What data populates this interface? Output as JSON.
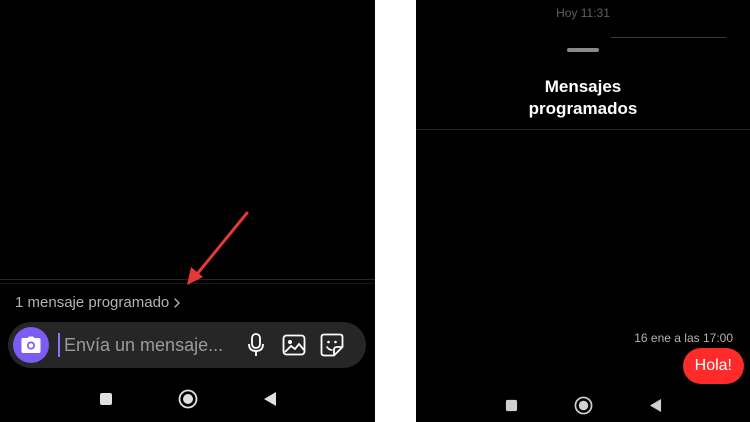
{
  "left_screen": {
    "scheduled_link": {
      "label": "1 mensaje programado"
    },
    "composer": {
      "placeholder": "Envía un mensaje..."
    },
    "icons": [
      "camera-icon",
      "microphone-icon",
      "gallery-icon",
      "sticker-icon",
      "chevron-right-icon",
      "red-arrow-annotation"
    ],
    "colors": {
      "camera_button": "#7b5cf5",
      "caret": "#8c72ff",
      "annotation_arrow": "#e53935",
      "composer_bg": "#262626"
    }
  },
  "right_screen": {
    "timestamp": "Hoy 11:31",
    "sheet": {
      "title_line1": "Mensajes",
      "title_line2": "programados"
    },
    "scheduled_message": {
      "time": "16 ene a las 17:00",
      "text": "Hola!"
    },
    "colors": {
      "bubble": "#ff2a2a"
    }
  },
  "navbar": {
    "icons": [
      "square-icon",
      "home-circle-icon",
      "back-triangle-icon"
    ]
  }
}
